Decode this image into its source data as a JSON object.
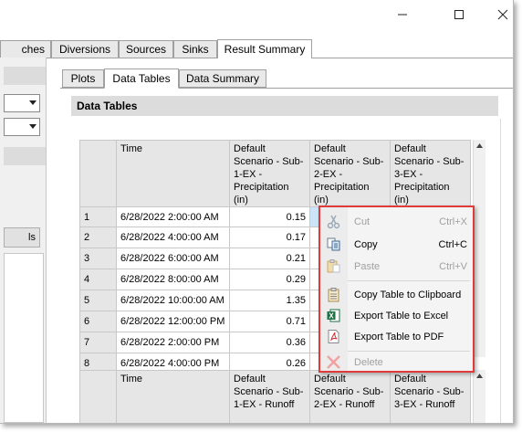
{
  "window": {
    "minimize_icon": "minimize-icon",
    "maximize_icon": "maximize-icon",
    "close_icon": "close-icon"
  },
  "main_tabs": [
    {
      "label": "ches"
    },
    {
      "label": "Diversions"
    },
    {
      "label": "Sources"
    },
    {
      "label": "Sinks"
    },
    {
      "label": "Result Summary"
    }
  ],
  "sub_tabs": [
    {
      "label": "Plots"
    },
    {
      "label": "Data Tables"
    },
    {
      "label": "Data Summary"
    }
  ],
  "left_pane": {
    "button_label": "ls"
  },
  "section_title": "Data Tables",
  "table1": {
    "headers": [
      "Time",
      "Default Scenario - Sub-1-EX - Precipitation (in)",
      "Default Scenario - Sub-2-EX - Precipitation (in)",
      "Default Scenario - Sub-3-EX - Precipitation (in)"
    ],
    "rows": [
      {
        "n": "1",
        "time": "6/28/2022 2:00:00 AM",
        "v1": "0.15"
      },
      {
        "n": "2",
        "time": "6/28/2022 4:00:00 AM",
        "v1": "0.17"
      },
      {
        "n": "3",
        "time": "6/28/2022 6:00:00 AM",
        "v1": "0.21"
      },
      {
        "n": "4",
        "time": "6/28/2022 8:00:00 AM",
        "v1": "0.29"
      },
      {
        "n": "5",
        "time": "6/28/2022 10:00:00 AM",
        "v1": "1.35"
      },
      {
        "n": "6",
        "time": "6/28/2022 12:00:00 PM",
        "v1": "0.71"
      },
      {
        "n": "7",
        "time": "6/28/2022 2:00:00 PM",
        "v1": "0.36"
      },
      {
        "n": "8",
        "time": "6/28/2022 4:00:00 PM",
        "v1": "0.26"
      }
    ]
  },
  "table2": {
    "headers": [
      "Time",
      "Default Scenario - Sub-1-EX - Runoff",
      "Default Scenario - Sub-2-EX - Runoff",
      "Default Scenario - Sub-3-EX - Runoff"
    ]
  },
  "context_menu": {
    "border_color": "#e03b3b",
    "items": [
      {
        "label": "Cut",
        "shortcut": "Ctrl+X",
        "icon": "scissors-icon",
        "enabled": false
      },
      {
        "label": "Copy",
        "shortcut": "Ctrl+C",
        "icon": "copy-icon",
        "enabled": true
      },
      {
        "label": "Paste",
        "shortcut": "Ctrl+V",
        "icon": "paste-icon",
        "enabled": false
      },
      {
        "label": "Copy Table to Clipboard",
        "shortcut": "",
        "icon": "clipboard-icon",
        "enabled": true
      },
      {
        "label": "Export Table to Excel",
        "shortcut": "",
        "icon": "excel-icon",
        "enabled": true
      },
      {
        "label": "Export Table to PDF",
        "shortcut": "",
        "icon": "pdf-icon",
        "enabled": true
      },
      {
        "label": "Delete",
        "shortcut": "",
        "icon": "delete-icon",
        "enabled": false
      }
    ]
  }
}
